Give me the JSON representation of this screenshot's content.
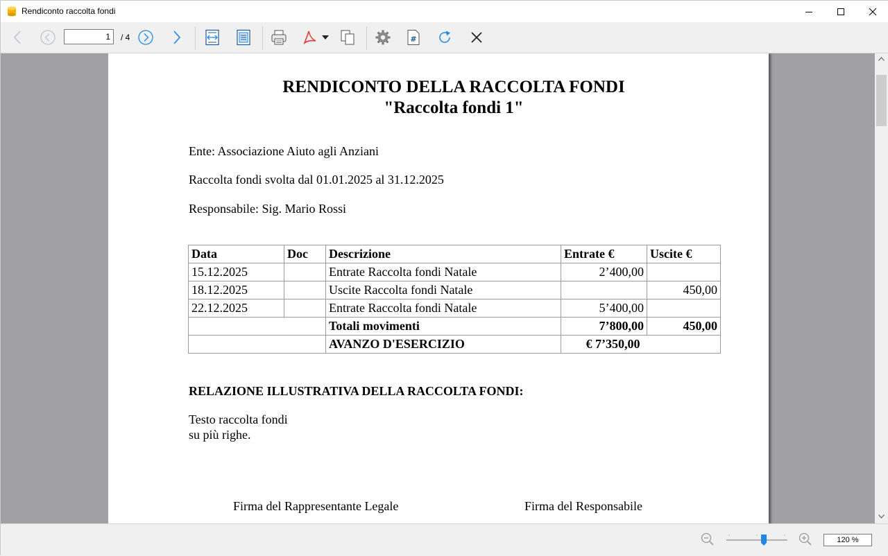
{
  "window": {
    "title": "Rendiconto raccolta fondi"
  },
  "toolbar": {
    "page_value": "1",
    "page_total": "/ 4"
  },
  "report": {
    "title_line1": "RENDICONTO DELLA RACCOLTA FONDI",
    "title_line2": "\"Raccolta fondi 1\"",
    "ente": "Ente: Associazione Aiuto agli Anziani",
    "periodo": "Raccolta fondi svolta dal 01.01.2025 al 31.12.2025",
    "responsabile": "Responsabile: Sig. Mario Rossi",
    "table": {
      "headers": [
        "Data",
        "Doc",
        "Descrizione",
        "Entrate €",
        "Uscite €"
      ],
      "rows": [
        {
          "data": "15.12.2025",
          "doc": "",
          "descrizione": "Entrate Raccolta fondi Natale",
          "entrate": "2’400,00",
          "uscite": ""
        },
        {
          "data": "18.12.2025",
          "doc": "",
          "descrizione": "Uscite Raccolta fondi Natale",
          "entrate": "",
          "uscite": "450,00"
        },
        {
          "data": "22.12.2025",
          "doc": "",
          "descrizione": "Entrate Raccolta fondi Natale",
          "entrate": "5’400,00",
          "uscite": ""
        }
      ],
      "totals": {
        "label": "Totali movimenti",
        "entrate": "7’800,00",
        "uscite": "450,00"
      },
      "avanzo": {
        "label": "AVANZO D'ESERCIZIO",
        "value": "€ 7’350,00"
      }
    },
    "relazione_title": "RELAZIONE ILLUSTRATIVA DELLA RACCOLTA FONDI:",
    "relazione_line1": "Testo raccolta fondi",
    "relazione_line2": "su più righe.",
    "firma_legale": "Firma del Rappresentante Legale",
    "firma_responsabile": "Firma del Responsabile"
  },
  "statusbar": {
    "zoom": "120 %",
    "zoom_level_percent": 120
  },
  "colors": {
    "accent_blue": "#1e88e5",
    "pdf_red": "#e53935",
    "viewer_gray": "#a0a0a5"
  },
  "icons": [
    "app-icon",
    "minimize-icon",
    "maximize-icon",
    "close-icon",
    "arrow-left-icon",
    "circle-left-icon",
    "circle-right-icon",
    "arrow-right-icon",
    "fit-width-icon",
    "fit-page-icon",
    "print-icon",
    "pdf-icon",
    "dropdown-arrow-icon",
    "copy-icon",
    "gear-icon",
    "page-number-icon",
    "refresh-icon",
    "close-x-icon",
    "zoom-out-icon",
    "zoom-in-icon"
  ]
}
